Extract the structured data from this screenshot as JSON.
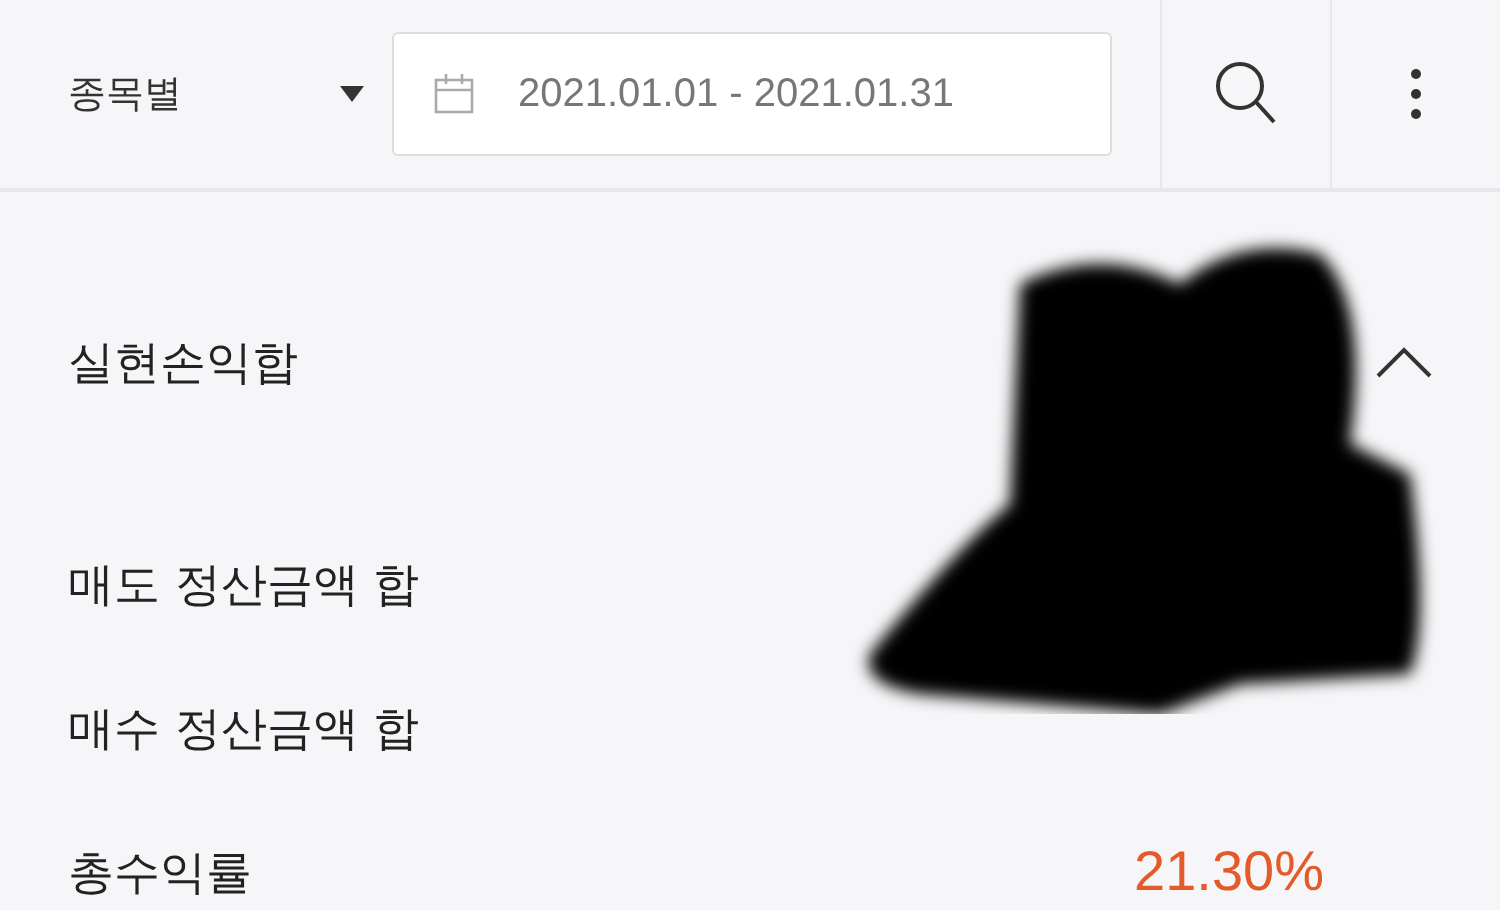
{
  "toolbar": {
    "filter": "종목별",
    "date_range": "2021.01.01 - 2021.01.31"
  },
  "summary": {
    "title": "실현손익합",
    "expanded": true,
    "redacted": true,
    "rows": [
      {
        "label": "매도 정산금액 합"
      },
      {
        "label": "매수 정산금액 합"
      },
      {
        "label": "총수익률",
        "value": "21.30%",
        "kind": "gain"
      }
    ]
  }
}
